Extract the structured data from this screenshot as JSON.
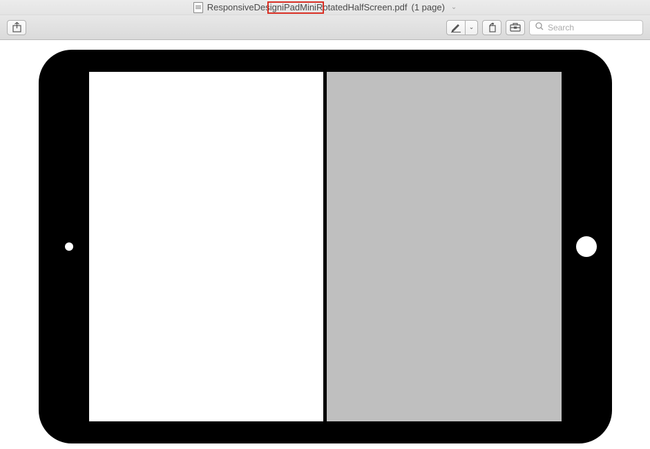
{
  "title": {
    "filename": "ResponsiveDesigniPadMiniRotatedHalfScreen.pdf",
    "page_info": "(1 page)"
  },
  "toolbar": {
    "search_placeholder": "Search"
  },
  "icons": {
    "share": "share-icon",
    "markup": "pencil-icon",
    "markup_dropdown": "chevron-down-icon",
    "rotate": "rotate-icon",
    "toolbox": "toolbox-icon",
    "search": "magnify-icon",
    "title_dropdown": "chevron-down-icon",
    "doc": "document-icon"
  }
}
